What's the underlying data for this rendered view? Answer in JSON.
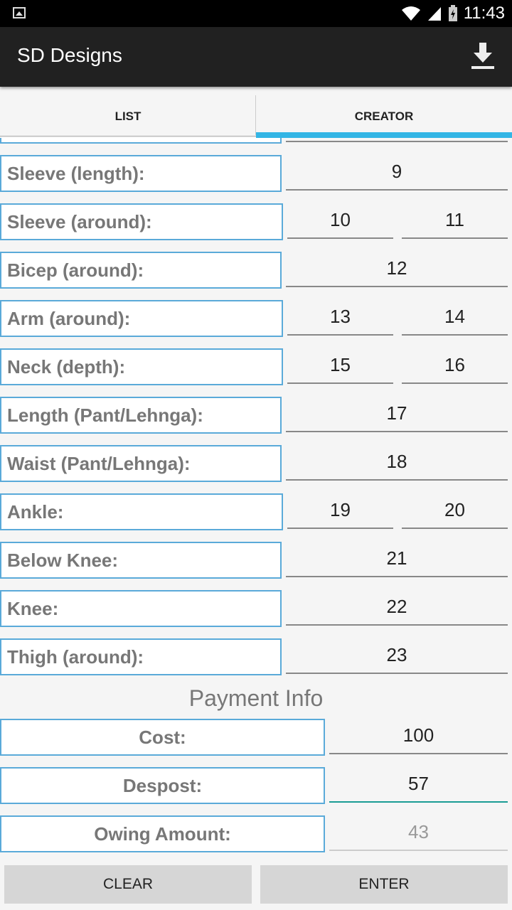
{
  "status_bar": {
    "time": "11:43"
  },
  "app_bar": {
    "title": "SD Designs",
    "download_icon": "download-icon"
  },
  "tabs": [
    {
      "label": "LIST"
    },
    {
      "label": "CREATOR",
      "selected": true
    }
  ],
  "measurements": [
    {
      "label": "Sleeve (length):",
      "values": [
        "9"
      ]
    },
    {
      "label": "Sleeve (around):",
      "values": [
        "10",
        "11"
      ]
    },
    {
      "label": "Bicep (around):",
      "values": [
        "12"
      ]
    },
    {
      "label": "Arm (around):",
      "values": [
        "13",
        "14"
      ]
    },
    {
      "label": "Neck (depth):",
      "values": [
        "15",
        "16"
      ]
    },
    {
      "label": "Length (Pant/Lehnga):",
      "values": [
        "17"
      ]
    },
    {
      "label": "Waist (Pant/Lehnga):",
      "values": [
        "18"
      ]
    },
    {
      "label": "Ankle:",
      "values": [
        "19",
        "20"
      ]
    },
    {
      "label": "Below Knee:",
      "values": [
        "21"
      ]
    },
    {
      "label": "Knee:",
      "values": [
        "22"
      ]
    },
    {
      "label": "Thigh (around):",
      "values": [
        "23"
      ]
    }
  ],
  "payment": {
    "title": "Payment Info",
    "rows": [
      {
        "label": "Cost:",
        "value": "100"
      },
      {
        "label": "Despost:",
        "value": "57"
      },
      {
        "label": "Owing Amount:",
        "value": "43"
      }
    ]
  },
  "buttons": {
    "clear": "CLEAR",
    "enter": "ENTER"
  },
  "colors": {
    "tab_indicator": "#33b5e5",
    "label_border": "#5aaad9",
    "active_underline": "#1a9c94",
    "app_bar": "#212121"
  }
}
